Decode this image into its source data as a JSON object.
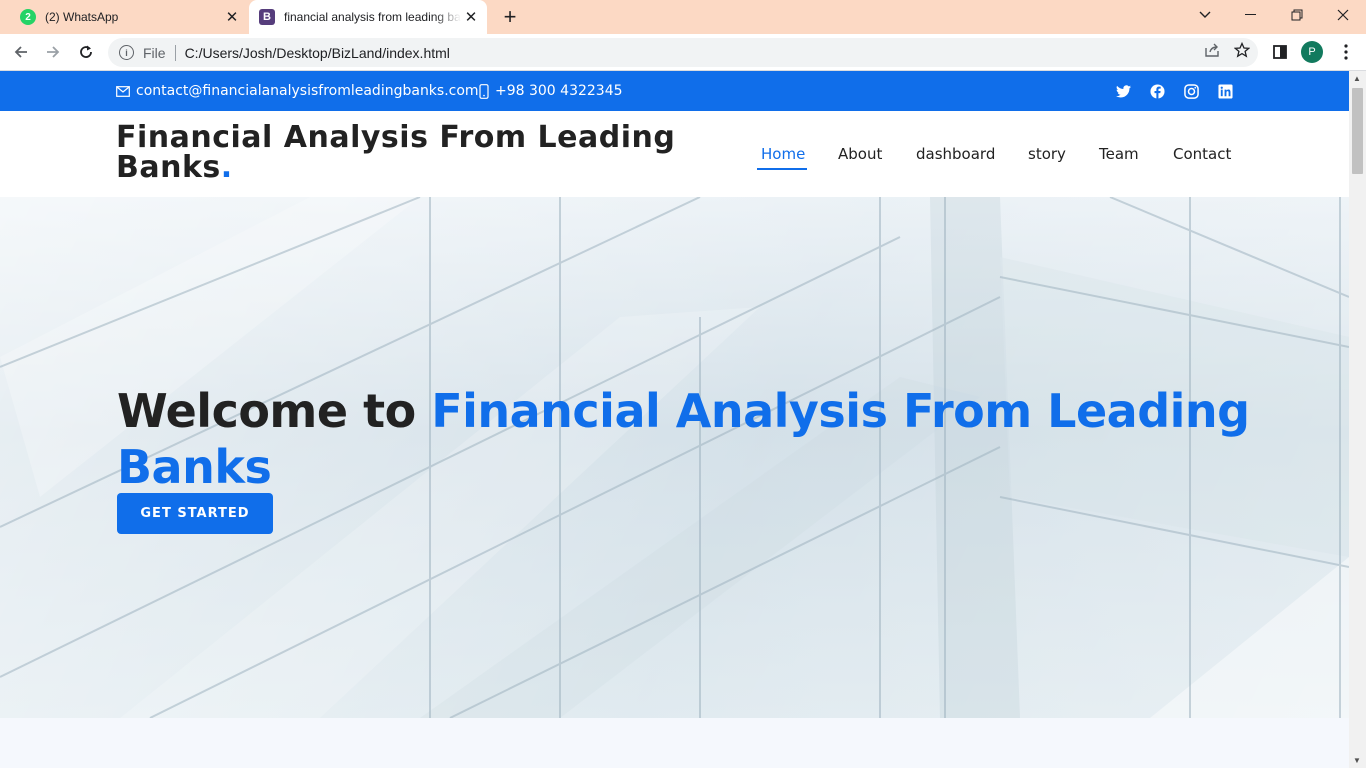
{
  "browser": {
    "tabs": [
      {
        "title": "(2) WhatsApp",
        "icon": "whatsapp-icon",
        "badge": "2"
      },
      {
        "title": "financial analysis from leading banks",
        "icon": "bootstrap-icon",
        "badge": "B"
      }
    ],
    "address": {
      "scheme_label": "File",
      "url": "C:/Users/Josh/Desktop/BizLand/index.html"
    },
    "profile_initial": "P"
  },
  "topbar": {
    "email": "contact@financialanalysisfromleadingbanks.com",
    "phone": "+98 300 4322345",
    "social": [
      "twitter-icon",
      "facebook-icon",
      "instagram-icon",
      "linkedin-icon"
    ]
  },
  "header": {
    "logo_text": "Financial Analysis From Leading Banks",
    "logo_dot": ".",
    "nav": [
      "Home",
      "About",
      "dashboard",
      "story",
      "Team",
      "Contact"
    ],
    "active_nav": "Home"
  },
  "hero": {
    "welcome": "Welcome to",
    "highlight": "Financial Analysis From Leading Banks",
    "cta": "GET STARTED"
  },
  "colors": {
    "primary": "#106eea",
    "text_dark": "#222222",
    "tabbar": "#fcd9c4"
  }
}
